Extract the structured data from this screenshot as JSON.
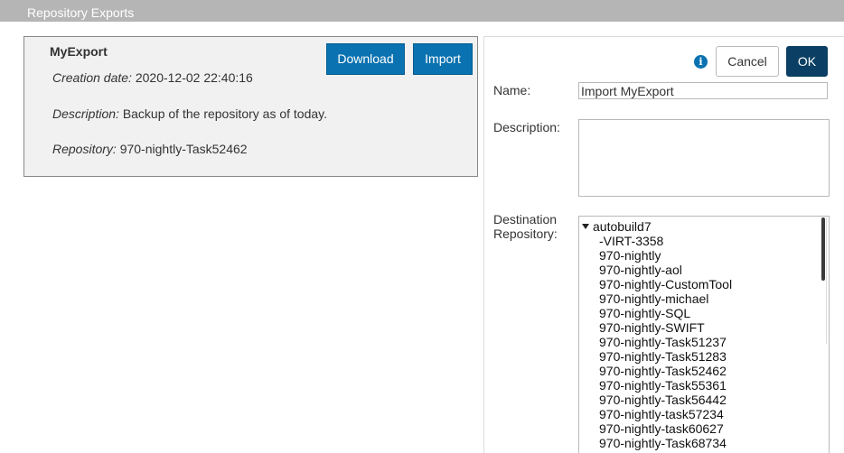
{
  "window": {
    "title": "Repository Exports"
  },
  "export": {
    "name": "MyExport",
    "creation_label": "Creation date:",
    "creation_value": "2020-12-02 22:40:16",
    "description_label": "Description:",
    "description_value": "Backup of the repository as of today.",
    "repository_label": "Repository:",
    "repository_value": "970-nightly-Task52462",
    "download_label": "Download",
    "import_label": "Import"
  },
  "form": {
    "info_icon": "info-icon",
    "cancel_label": "Cancel",
    "ok_label": "OK",
    "name_label": "Name:",
    "name_value": "Import MyExport",
    "description_label": "Description:",
    "description_value": "",
    "destination_label_line1": "Destination",
    "destination_label_line2": "Repository:",
    "tree_root": "autobuild7",
    "repositories": [
      "-VIRT-3358",
      "970-nightly",
      "970-nightly-aol",
      "970-nightly-CustomTool",
      "970-nightly-michael",
      "970-nightly-SQL",
      "970-nightly-SWIFT",
      "970-nightly-Task51237",
      "970-nightly-Task51283",
      "970-nightly-Task52462",
      "970-nightly-Task55361",
      "970-nightly-Task56442",
      "970-nightly-task57234",
      "970-nightly-task60627",
      "970-nightly-Task68734"
    ]
  },
  "colors": {
    "primary_button": "#0a72b0",
    "ok_button": "#0b3f63",
    "titlebar": "#b5b5b5"
  }
}
